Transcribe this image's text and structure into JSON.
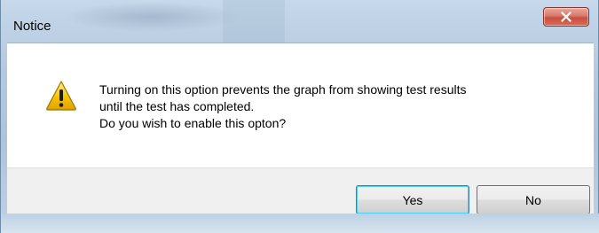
{
  "dialog": {
    "title": "Notice",
    "message_lines": [
      "Turning on this option prevents the graph from showing test results",
      "until the test has completed.",
      "Do you wish to enable this opton?"
    ],
    "icon": "warning-icon",
    "buttons": {
      "yes_label": "Yes",
      "no_label": "No"
    },
    "default_button": "yes"
  },
  "colors": {
    "close_button": "#c8503f",
    "warning_yellow": "#f5c400",
    "default_button_focus": "#48d2f8"
  }
}
